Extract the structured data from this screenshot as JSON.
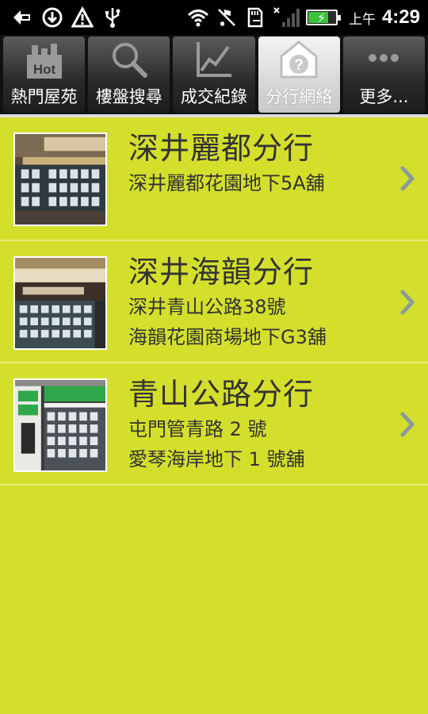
{
  "status_bar": {
    "icons_left": [
      "back-arrow-icon",
      "download-icon",
      "alert-triangle-icon",
      "usb-icon"
    ],
    "icons_right": [
      "wifi-icon",
      "no-sound-icon",
      "sd-card-icon",
      "no-signal-icon"
    ],
    "ampm": "上午",
    "time": "4:29",
    "battery_level": 0.75,
    "battery_color": "#3cc23a"
  },
  "tabs": [
    {
      "label": "熱門屋苑",
      "icon": "hot-buildings-icon",
      "active": false
    },
    {
      "label": "樓盤搜尋",
      "icon": "search-icon",
      "active": false
    },
    {
      "label": "成交紀錄",
      "icon": "line-chart-icon",
      "active": false
    },
    {
      "label": "分行網絡",
      "icon": "house-question-icon",
      "active": true
    },
    {
      "label": "更多...",
      "icon": "more-dots-icon",
      "active": false
    }
  ],
  "branches": [
    {
      "name": "深井麗都分行",
      "address_lines": [
        "深井麗都花園地下5A舖"
      ],
      "photo": "branch-photo-icon"
    },
    {
      "name": "深井海韻分行",
      "address_lines": [
        "深井青山公路38號",
        "海韻花園商場地下G3舖"
      ],
      "photo": "branch-photo-icon"
    },
    {
      "name": "青山公路分行",
      "address_lines": [
        "屯門管青路 2 號",
        "愛琴海岸地下 1 號舖"
      ],
      "photo": "branch-photo-icon"
    }
  ],
  "colors": {
    "background": "#d4df2c",
    "text": "#333333",
    "chevron": "#8c9a9a"
  }
}
